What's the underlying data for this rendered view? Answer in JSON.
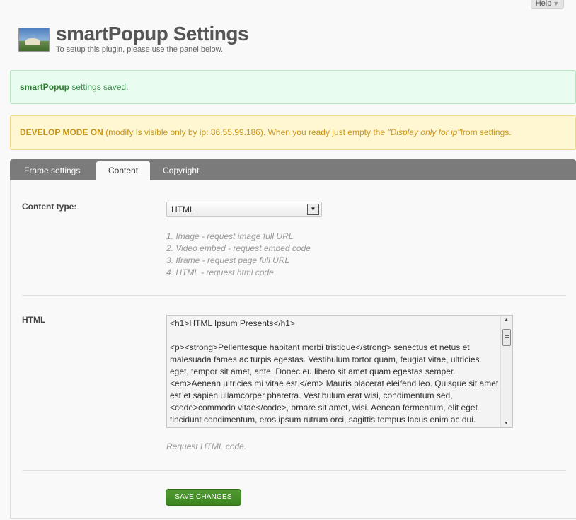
{
  "header": {
    "help_label": "Help",
    "title": "smartPopup Settings",
    "subtitle": "To setup this plugin, please use the panel below."
  },
  "notices": {
    "success": {
      "strong": "smartPopup",
      "text": "settings saved."
    },
    "warning": {
      "strong": "DEVELOP MODE ON",
      "text": "(modify is visible only by ip: 86.55.99.186). When you ready just empty the",
      "emphasis": "\"Display only for ip\"",
      "tail": "from settings."
    }
  },
  "tabs": [
    {
      "label": "Frame settings",
      "active": false
    },
    {
      "label": "Content",
      "active": true
    },
    {
      "label": "Copyright",
      "active": false
    }
  ],
  "content_type": {
    "label": "Content type:",
    "selected": "HTML",
    "help": [
      "1. Image - request image full URL",
      "2. Video embed - request embed code",
      "3. Iframe - request page full URL",
      "4. HTML - request html code"
    ]
  },
  "html_field": {
    "label": "HTML",
    "value": "<h1>HTML Ipsum Presents</h1>\n\n<p><strong>Pellentesque habitant morbi tristique</strong> senectus et netus et malesuada fames ac turpis egestas. Vestibulum tortor quam, feugiat vitae, ultricies eget, tempor sit amet, ante. Donec eu libero sit amet quam egestas semper. <em>Aenean ultricies mi vitae est.</em> Mauris placerat eleifend leo. Quisque sit amet est et sapien ullamcorper pharetra. Vestibulum erat wisi, condimentum sed, <code>commodo vitae</code>, ornare sit amet, wisi. Aenean fermentum, elit eget tincidunt condimentum, eros ipsum rutrum orci, sagittis tempus lacus enim ac dui.",
    "hint": "Request HTML code."
  },
  "save_button": {
    "label": "SAVE CHANGES"
  },
  "colors": {
    "tab_bar": "#7b7b7b",
    "success_bg": "#e8fcef",
    "warning_bg": "#fff7d2",
    "save_button": "#3d8420"
  }
}
